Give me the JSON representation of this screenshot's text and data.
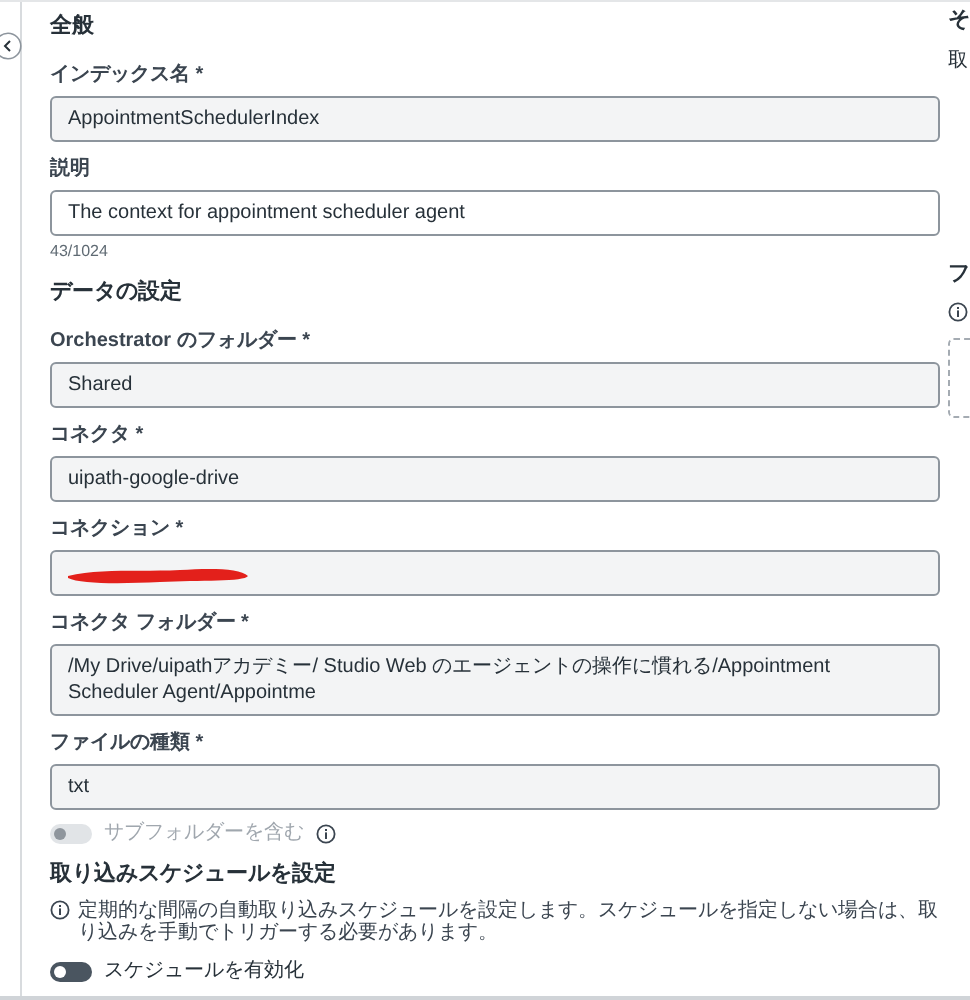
{
  "general": {
    "title": "全般",
    "fields": [
      {
        "label": "インデックス名 *",
        "value": "AppointmentSchedulerIndex",
        "disabled": true
      },
      {
        "label": "説明",
        "value": "The context for appointment scheduler agent",
        "disabled": false,
        "counter": "43/1024"
      }
    ]
  },
  "data_settings": {
    "title": "データの設定",
    "fields": [
      {
        "label": "Orchestrator のフォルダー *",
        "value": "Shared",
        "disabled": true
      },
      {
        "label": "コネクタ *",
        "value": "uipath-google-drive",
        "disabled": true
      },
      {
        "label": "コネクション *",
        "disabled": true,
        "redacted": true
      },
      {
        "label": "コネクタ フォルダー *",
        "value": "/My Drive/uipathアカデミー/ Studio Web のエージェントの操作に慣れる/Appointment Scheduler Agent/Appointme",
        "disabled": true
      },
      {
        "label": "ファイルの種類 *",
        "value": "txt",
        "disabled": true
      }
    ],
    "subfolder_toggle": {
      "label": "サブフォルダーを含む",
      "on": false,
      "disabled": true
    }
  },
  "schedule": {
    "title": "取り込みスケジュールを設定",
    "note": "定期的な間隔の自動取り込みスケジュールを設定します。スケジュールを指定しない場合は、取り込みを手動でトリガーする必要があります。",
    "toggle": {
      "label": "スケジュールを有効化",
      "on": false,
      "disabled": false
    }
  },
  "right_panel": {
    "title": "そ",
    "subtitle": "取",
    "section": "フ"
  }
}
